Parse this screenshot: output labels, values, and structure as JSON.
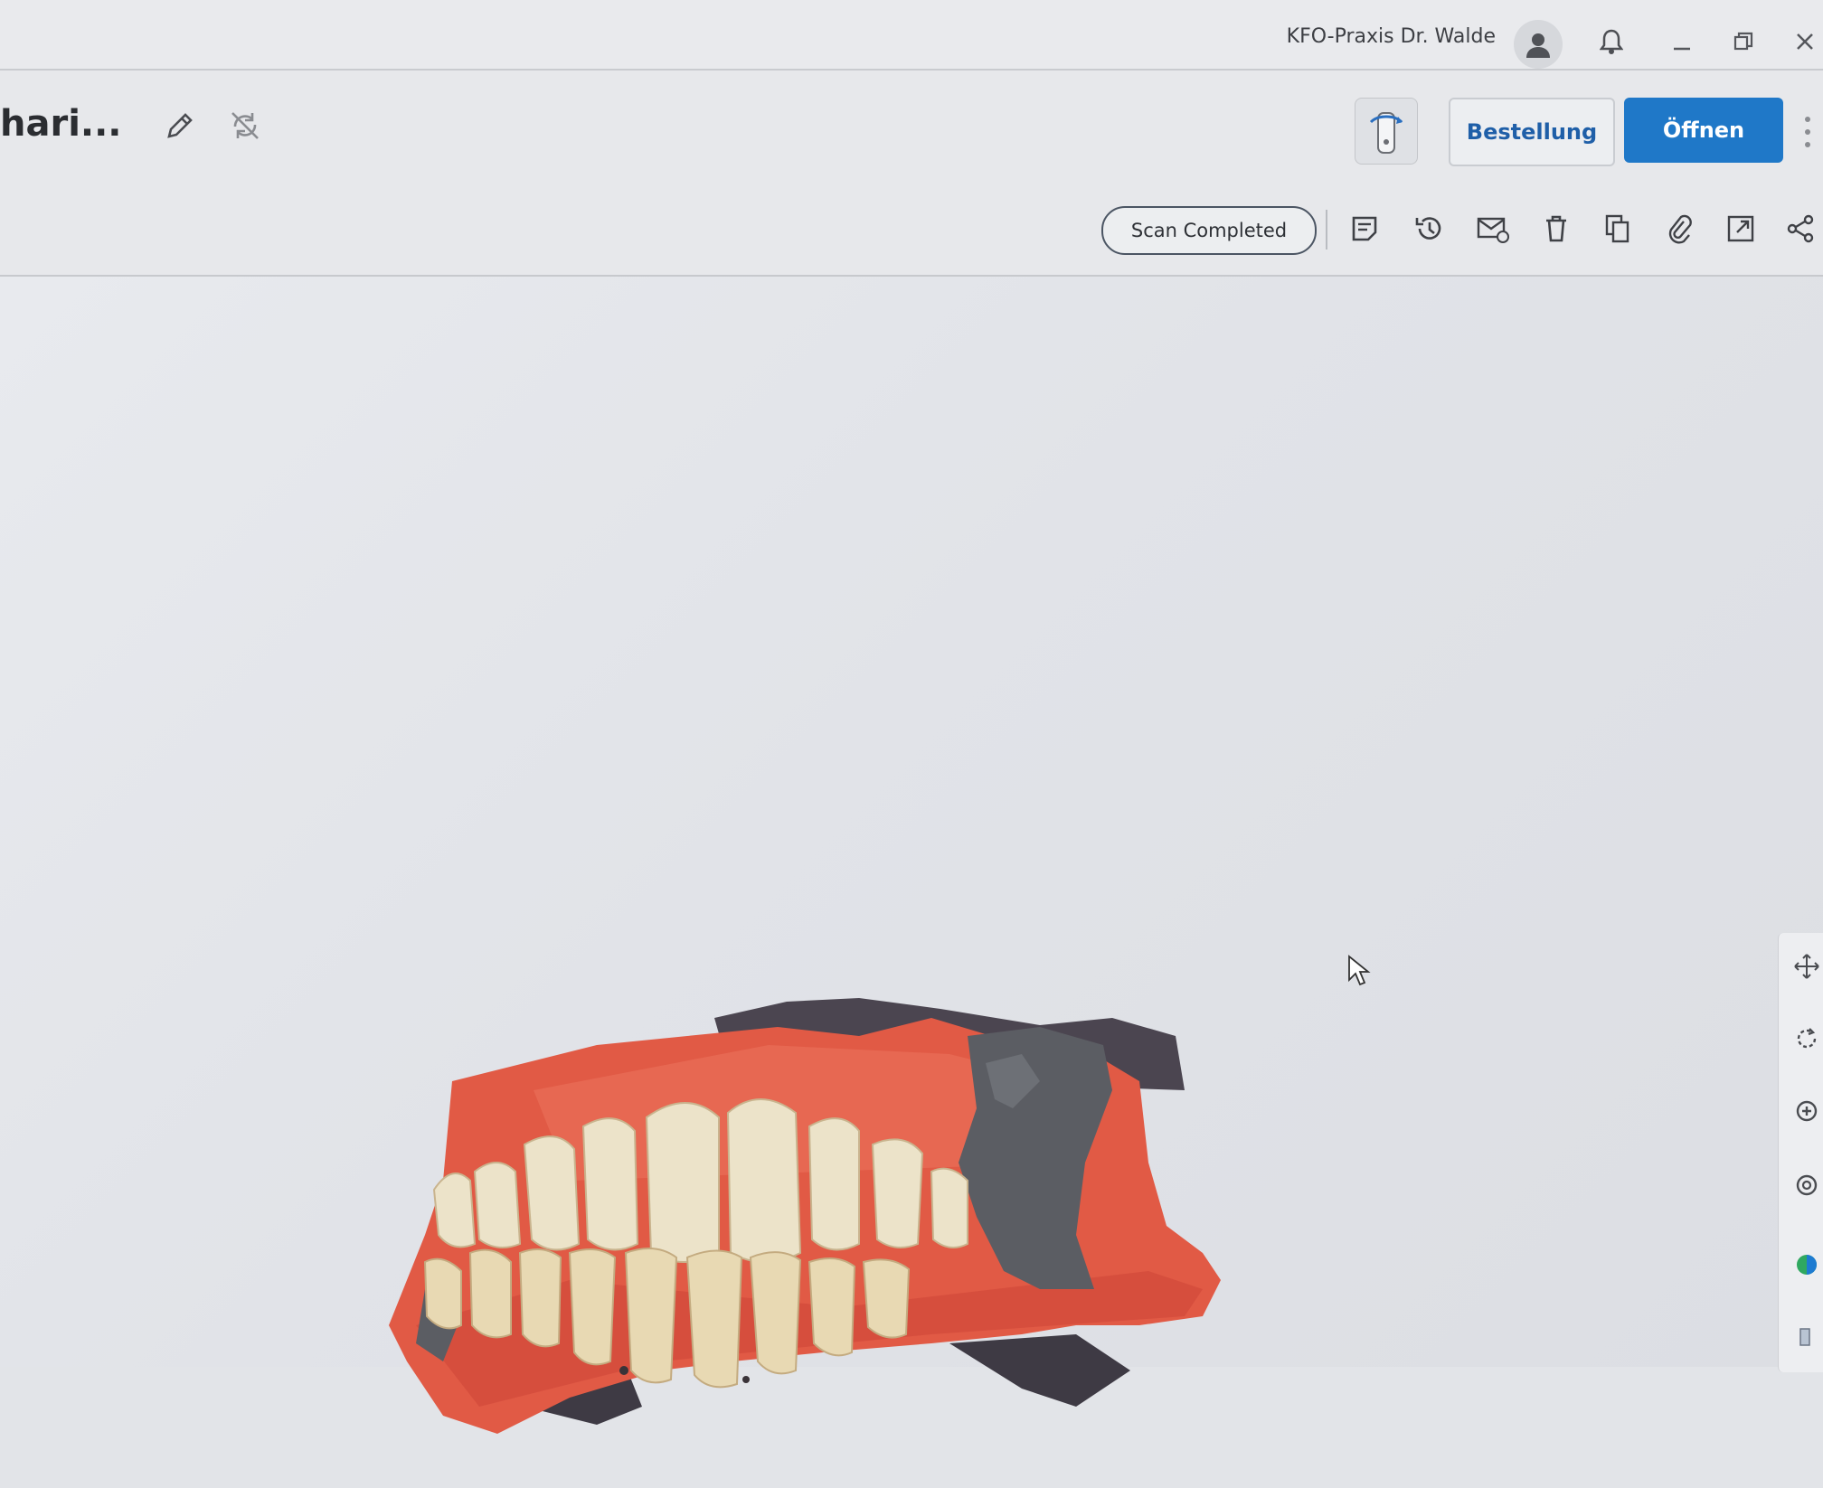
{
  "titlebar": {
    "practice_name": "KFO-Praxis Dr. Walde",
    "icons": [
      "user-icon",
      "bell-icon",
      "minimize-icon",
      "restore-icon",
      "close-icon"
    ]
  },
  "header": {
    "case_title": "hari...",
    "actions": {
      "order_label": "Bestellung",
      "open_label": "Öffnen"
    },
    "status": "Scan Completed",
    "toolbar_icons": [
      "notes-icon",
      "history-icon",
      "mail-icon",
      "delete-icon",
      "copy-icon",
      "attach-icon",
      "export-icon",
      "share-icon"
    ]
  },
  "viewport": {
    "side_tools": [
      "pan-icon",
      "rotate-icon",
      "zoom-in-icon",
      "zoom-fit-icon",
      "color-icon"
    ]
  },
  "colors": {
    "accent": "#1f78c8",
    "accent_text": "#1f5fa8",
    "gum": "#e35a46",
    "tooth": "#ece3c9",
    "unscanned": "#5b5d63"
  }
}
